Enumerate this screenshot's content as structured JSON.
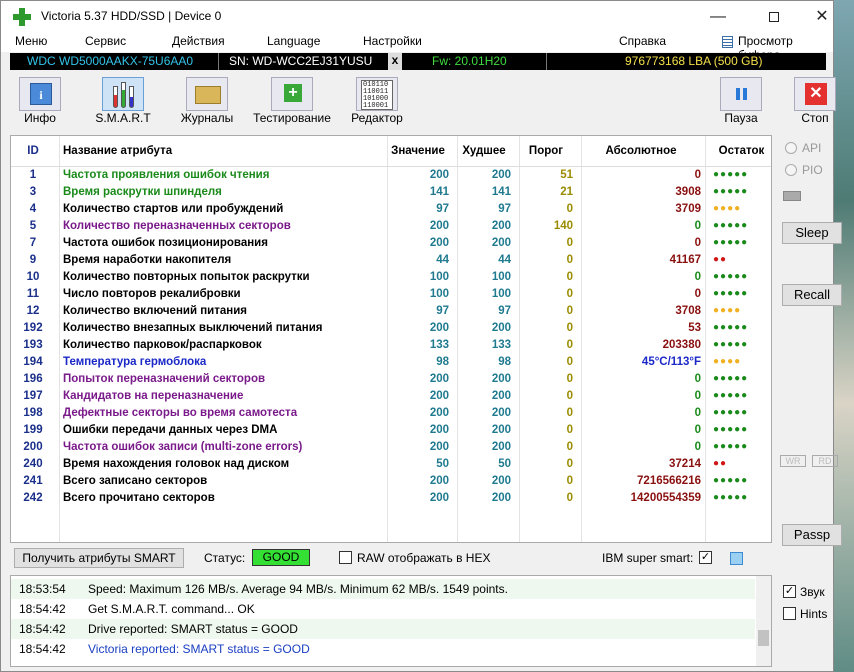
{
  "window": {
    "title": "Victoria 5.37 HDD/SSD | Device 0"
  },
  "menu": [
    "Меню",
    "Сервис",
    "Действия",
    "Language",
    "Настройки",
    "Справка",
    "Просмотр буфера"
  ],
  "drive": {
    "model": "WDC WD5000AAKX-75U6AA0",
    "serial": "SN: WD-WCC2EJ31YUSU",
    "x": "x",
    "firmware": "Fw: 20.01H20",
    "lba": "976773168 LBA (500 GB)"
  },
  "toolbar": {
    "info": "Инфо",
    "smart": "S.M.A.R.T",
    "journals": "Журналы",
    "testing": "Тестирование",
    "editor": "Редактор",
    "pause": "Пауза",
    "stop": "Стоп",
    "binary_text": [
      "010110",
      "110011",
      "101000",
      "110001"
    ]
  },
  "table": {
    "headers": [
      "ID",
      "Название атрибута",
      "Значение",
      "Худшее",
      "Порог",
      "Абсолютное",
      "Остаток"
    ],
    "rows": [
      {
        "id": "1",
        "name": "Частота проявления ошибок чтения",
        "val": "200",
        "worst": "200",
        "thr": "51",
        "raw": "0",
        "dots": "●●●●●",
        "name_color": "#1a8a1a",
        "raw_color": "#8a1010",
        "dot_color": "#1a8a1a"
      },
      {
        "id": "3",
        "name": "Время раскрутки шпинделя",
        "val": "141",
        "worst": "141",
        "thr": "21",
        "raw": "3908",
        "dots": "●●●●●",
        "name_color": "#1a8a1a",
        "raw_color": "#8a1010",
        "dot_color": "#1a8a1a"
      },
      {
        "id": "4",
        "name": "Количество стартов или пробуждений",
        "val": "97",
        "worst": "97",
        "thr": "0",
        "raw": "3709",
        "dots": "●●●●",
        "name_color": "#000000",
        "raw_color": "#8a1010",
        "dot_color": "#f0b020"
      },
      {
        "id": "5",
        "name": "Количество переназначенных секторов",
        "val": "200",
        "worst": "200",
        "thr": "140",
        "raw": "0",
        "dots": "●●●●●",
        "name_color": "#7a1a8a",
        "raw_color": "#1a8a1a",
        "dot_color": "#1a8a1a"
      },
      {
        "id": "7",
        "name": "Частота ошибок позиционирования",
        "val": "200",
        "worst": "200",
        "thr": "0",
        "raw": "0",
        "dots": "●●●●●",
        "name_color": "#000000",
        "raw_color": "#8a1010",
        "dot_color": "#1a8a1a"
      },
      {
        "id": "9",
        "name": "Время наработки накопителя",
        "val": "44",
        "worst": "44",
        "thr": "0",
        "raw": "41167",
        "dots": "●●",
        "name_color": "#000000",
        "raw_color": "#8a1010",
        "dot_color": "#d01818"
      },
      {
        "id": "10",
        "name": "Количество повторных попыток раскрутки",
        "val": "100",
        "worst": "100",
        "thr": "0",
        "raw": "0",
        "dots": "●●●●●",
        "name_color": "#000000",
        "raw_color": "#1a8a1a",
        "dot_color": "#1a8a1a"
      },
      {
        "id": "11",
        "name": "Число повторов рекалибровки",
        "val": "100",
        "worst": "100",
        "thr": "0",
        "raw": "0",
        "dots": "●●●●●",
        "name_color": "#000000",
        "raw_color": "#8a1010",
        "dot_color": "#1a8a1a"
      },
      {
        "id": "12",
        "name": "Количество включений питания",
        "val": "97",
        "worst": "97",
        "thr": "0",
        "raw": "3708",
        "dots": "●●●●",
        "name_color": "#000000",
        "raw_color": "#8a1010",
        "dot_color": "#f0b020"
      },
      {
        "id": "192",
        "name": "Количество внезапных выключений питания",
        "val": "200",
        "worst": "200",
        "thr": "0",
        "raw": "53",
        "dots": "●●●●●",
        "name_color": "#000000",
        "raw_color": "#8a1010",
        "dot_color": "#1a8a1a"
      },
      {
        "id": "193",
        "name": "Количество парковок/распарковок",
        "val": "133",
        "worst": "133",
        "thr": "0",
        "raw": "203380",
        "dots": "●●●●●",
        "name_color": "#000000",
        "raw_color": "#8a1010",
        "dot_color": "#1a8a1a"
      },
      {
        "id": "194",
        "name": "Температура гермоблока",
        "val": "98",
        "worst": "98",
        "thr": "0",
        "raw": "45°C/113°F",
        "dots": "●●●●",
        "name_color": "#1a28c8",
        "raw_color": "#1a28c8",
        "dot_color": "#f0b020"
      },
      {
        "id": "196",
        "name": "Попыток переназначений секторов",
        "val": "200",
        "worst": "200",
        "thr": "0",
        "raw": "0",
        "dots": "●●●●●",
        "name_color": "#7a1a8a",
        "raw_color": "#1a8a1a",
        "dot_color": "#1a8a1a"
      },
      {
        "id": "197",
        "name": "Кандидатов на переназначение",
        "val": "200",
        "worst": "200",
        "thr": "0",
        "raw": "0",
        "dots": "●●●●●",
        "name_color": "#7a1a8a",
        "raw_color": "#1a8a1a",
        "dot_color": "#1a8a1a"
      },
      {
        "id": "198",
        "name": "Дефектные секторы во время самотеста",
        "val": "200",
        "worst": "200",
        "thr": "0",
        "raw": "0",
        "dots": "●●●●●",
        "name_color": "#7a1a8a",
        "raw_color": "#1a8a1a",
        "dot_color": "#1a8a1a"
      },
      {
        "id": "199",
        "name": "Ошибки передачи данных через DMA",
        "val": "200",
        "worst": "200",
        "thr": "0",
        "raw": "0",
        "dots": "●●●●●",
        "name_color": "#000000",
        "raw_color": "#1a8a1a",
        "dot_color": "#1a8a1a"
      },
      {
        "id": "200",
        "name": "Частота ошибок записи (multi-zone errors)",
        "val": "200",
        "worst": "200",
        "thr": "0",
        "raw": "0",
        "dots": "●●●●●",
        "name_color": "#7a1a8a",
        "raw_color": "#1a8a1a",
        "dot_color": "#1a8a1a"
      },
      {
        "id": "240",
        "name": "Время нахождения головок над диском",
        "val": "50",
        "worst": "50",
        "thr": "0",
        "raw": "37214",
        "dots": "●●",
        "name_color": "#000000",
        "raw_color": "#8a1010",
        "dot_color": "#d01818"
      },
      {
        "id": "241",
        "name": "Всего записано секторов",
        "val": "200",
        "worst": "200",
        "thr": "0",
        "raw": "7216566216",
        "dots": "●●●●●",
        "name_color": "#000000",
        "raw_color": "#8a1010",
        "dot_color": "#1a8a1a"
      },
      {
        "id": "242",
        "name": "Всего прочитано секторов",
        "val": "200",
        "worst": "200",
        "thr": "0",
        "raw": "14200554359",
        "dots": "●●●●●",
        "name_color": "#000000",
        "raw_color": "#8a1010",
        "dot_color": "#1a8a1a"
      }
    ]
  },
  "right_panel": {
    "api": "API",
    "pio": "PIO",
    "sleep": "Sleep",
    "recall": "Recall",
    "wr": "WR",
    "rd": "RD",
    "passp": "Passp"
  },
  "status": {
    "get_button": "Получить атрибуты SMART",
    "label": "Статус:",
    "value": "GOOD",
    "raw_hex": "RAW отображать в HEX",
    "ibm": "IBM super smart:",
    "ibm_check": "✓"
  },
  "log": [
    {
      "time": "18:53:54",
      "msg": "Speed: Maximum 126 MB/s. Average 94 MB/s. Minimum 62 MB/s. 1549 points."
    },
    {
      "time": "18:54:42",
      "msg": "Get S.M.A.R.T. command... OK"
    },
    {
      "time": "18:54:42",
      "msg": "Drive reported: SMART status = GOOD"
    },
    {
      "time": "18:54:42",
      "msg": "Victoria reported: SMART status = GOOD"
    }
  ],
  "side_checks": {
    "sound": "Звук",
    "sound_check": "✓",
    "hints": "Hints"
  }
}
